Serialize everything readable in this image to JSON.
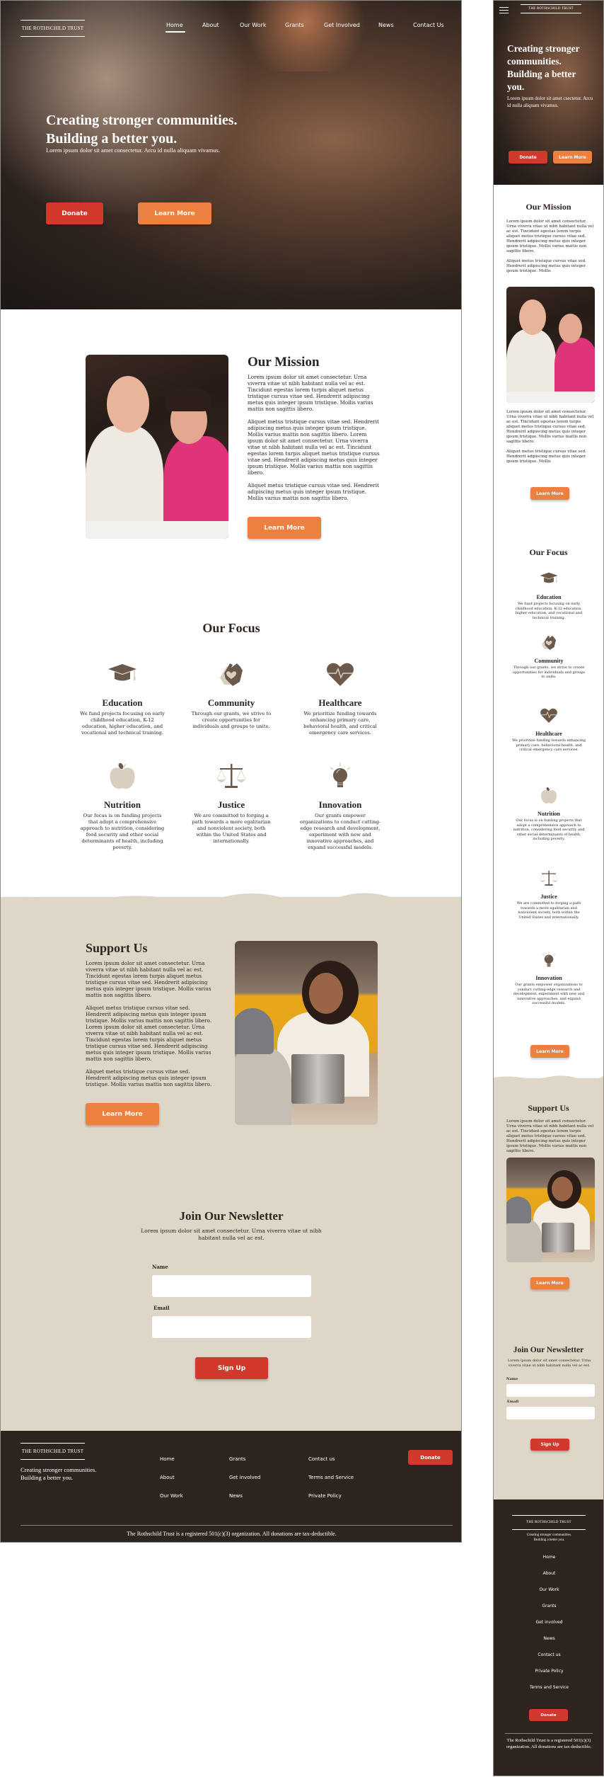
{
  "brand": {
    "name": "THE ROTHSCHILD TRUST",
    "tagline_line1": "Creating stronger communities.",
    "tagline_line2": "Building a better you."
  },
  "colors": {
    "primary_red": "#d0392b",
    "accent_orange": "#ec8040",
    "beige": "#ded7c8",
    "dark": "#2d2420",
    "icon_brown": "#6b5a4b",
    "icon_light": "#d9cfc0"
  },
  "nav": {
    "items": [
      "Home",
      "About",
      "Our Work",
      "Grants",
      "Get Involved",
      "News",
      "Contact Us"
    ],
    "active": "Home",
    "menu_icon": "hamburger-icon"
  },
  "hero": {
    "headline_line1": "Creating stronger communities.",
    "headline_line2": "Building a better you.",
    "mobile_headline": "Creating stronger communities. Building a better you.",
    "body": "Lorem ipsum dolor sit amet consectetur. Arcu id nulla aliquam vivamus.",
    "mobile_body": "Lorem ipsum dolor sit amet csectetur. Arcu id nulla aliquam vivamus.",
    "donate_label": "Donate",
    "learn_more_label": "Learn More"
  },
  "mission": {
    "title": "Our Mission",
    "paragraphs": [
      "Lorem ipsum dolor sit amet consectetur. Urna viverra vitae ut nibh habitant nulla vel ac est. Tincidunt egestas lorem turpis aliquet metus tristique cursus vitae sed. Hendrerit adipiscing metus quis integer ipsum tristique. Mollis varius mattis non sagittis libero.",
      "Aliquet metus tristique cursus vitae sed. Hendrerit adipiscing metus quis integer ipsum tristique. Mollis varius mattis non sagittis libero. Lorem ipsum dolor sit amet consectetur. Urna viverra vitae ut nibh habitant nulla vel ac est. Tincidunt egestas lorem turpis aliquet metus tristique cursus vitae sed. Hendrerit adipiscing metus quis integer ipsum tristique. Mollis varius mattis non sagittis libero.",
      "Aliquet metus tristique cursus vitae sed. Hendrerit adipiscing metus quis integer ipsum tristique. Mollis varius mattis non sagittis libero."
    ],
    "mobile_short_paragraph": "Aliquet metus tristique cursus vitae sed. Hendrerit adipiscing metus quis integer ipsum tristique. Mollis",
    "button_label": "Learn More"
  },
  "focus": {
    "title": "Our Focus",
    "items": [
      {
        "icon": "graduation-cap-icon",
        "title": "Education",
        "text": "We fund projects focusing on early childhood education, K-12 education, higher education, and vocational and technical training."
      },
      {
        "icon": "hands-heart-icon",
        "title": "Community",
        "text": "Through our grants, we strive to create opportunities for individuals and groups to unite."
      },
      {
        "icon": "heartbeat-icon",
        "title": "Healthcare",
        "text": "We prioritize funding towards enhancing primary care, behavioral health, and critical emergency care services."
      },
      {
        "icon": "apple-icon",
        "title": "Nutrition",
        "text": "Our focus is on funding projects that adopt a comprehensive approach to nutrition, considering food security and other social determinants of health, including poverty."
      },
      {
        "icon": "scales-icon",
        "title": "Justice",
        "text": "We are committed to forging a path towards a more egalitarian and nonviolent society, both within the United States and internationally."
      },
      {
        "icon": "lightbulb-icon",
        "title": "Innovation",
        "text": "Our grants empower organizations to conduct cutting-edge research and development, experiment with new and innovative approaches, and expand successful models."
      }
    ],
    "mobile_button_label": "Learn More"
  },
  "support": {
    "title": "Support Us",
    "button_label": "Learn More"
  },
  "newsletter": {
    "title": "Join Our Newsletter",
    "text": "Lorem ipsum dolor sit amet consectetur. Urna viverra vitae ut nibh habitant nulla vel ac est.",
    "name_label": "Name",
    "name_value": "",
    "email_label": "Email",
    "email_value": "",
    "submit_label": "Sign Up"
  },
  "footer": {
    "columns": [
      [
        "Home",
        "About",
        "Our Work"
      ],
      [
        "Grants",
        "Get involved",
        "News"
      ],
      [
        "Contact us",
        "Terms and Service",
        "Private Policy"
      ]
    ],
    "mobile_links": [
      "Home",
      "About",
      "Our Work",
      "Grants",
      "Get involved",
      "News",
      "Contact us",
      "Private Policy",
      "Terms and Service"
    ],
    "donate_label": "Donate",
    "copyright": "The Rothschild Trust is a registered 501(c)(3) organization. All donations are tax-deductible."
  }
}
